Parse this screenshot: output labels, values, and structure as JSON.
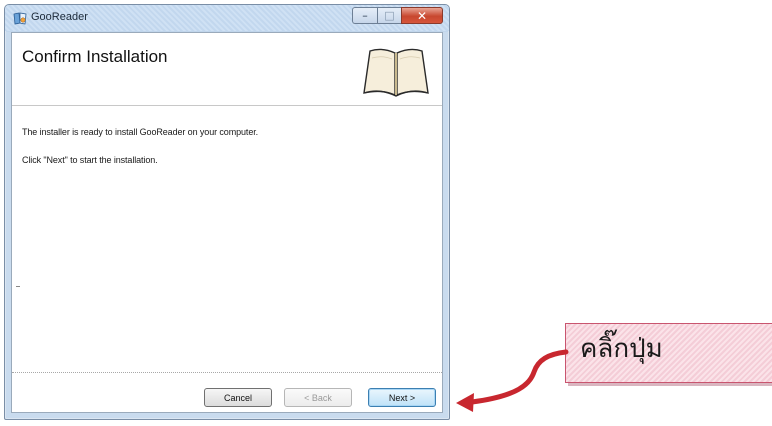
{
  "window": {
    "title": "GooReader",
    "controls": {
      "minimize": "–",
      "maximize": "□",
      "close": "✕"
    }
  },
  "header": {
    "title": "Confirm Installation",
    "image_icon": "open-book-icon"
  },
  "body": {
    "line1": "The installer is ready to install GooReader on your computer.",
    "line2": "Click \"Next\" to start the installation."
  },
  "buttons": {
    "cancel": "Cancel",
    "back": "< Back",
    "next": "Next >"
  },
  "annotation": {
    "text": "คลิ๊กปุ่ม",
    "arrow_color": "#c8272f",
    "box_color": "#f7d3dc"
  }
}
